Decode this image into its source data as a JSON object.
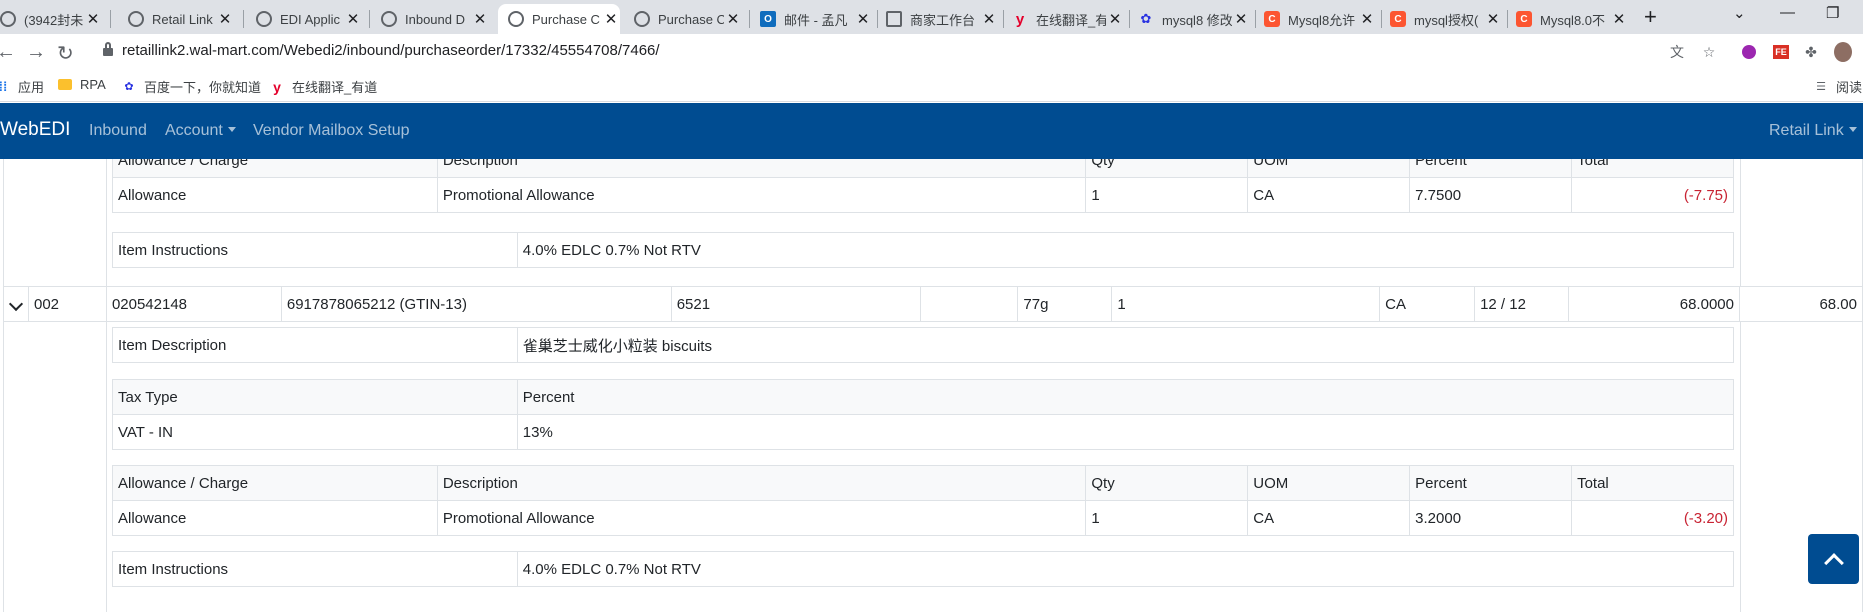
{
  "browser": {
    "tabs": [
      {
        "label": "(3942封未",
        "icon": "globe-icon"
      },
      {
        "label": "Retail Link",
        "icon": "globe-icon"
      },
      {
        "label": "EDI Applic",
        "icon": "globe-icon"
      },
      {
        "label": "Inbound D",
        "icon": "globe-icon"
      },
      {
        "label": "Purchase C",
        "icon": "globe-icon",
        "active": true
      },
      {
        "label": "Purchase C",
        "icon": "globe-icon"
      },
      {
        "label": "邮件 - 孟凡",
        "icon": "outlook-icon"
      },
      {
        "label": "商家工作台",
        "icon": "shop-icon"
      },
      {
        "label": "在线翻译_有",
        "icon": "youdao-icon"
      },
      {
        "label": "mysql8 修改",
        "icon": "baidu-icon"
      },
      {
        "label": "Mysql8允许",
        "icon": "csdn-icon"
      },
      {
        "label": "mysql授权(",
        "icon": "csdn-icon"
      },
      {
        "label": "Mysql8.0不",
        "icon": "csdn-icon"
      }
    ],
    "url": "retaillink2.wal-mart.com/Webedi2/inbound/purchaseorder/17332/45554708/7466/",
    "bookmarks": [
      {
        "label": "应用",
        "icon": "apps-icon"
      },
      {
        "label": "RPA",
        "icon": "folder-icon"
      },
      {
        "label": "百度一下，你就知道",
        "icon": "baidu-icon"
      },
      {
        "label": "在线翻译_有道",
        "icon": "youdao-icon"
      }
    ],
    "reading_list": "阅读"
  },
  "appnav": {
    "brand": "WebEDI",
    "links": [
      "Inbound",
      "Account",
      "Vendor Mailbox Setup"
    ],
    "right_link": "Retail Link"
  },
  "allowance_headers": [
    "Allowance / Charge",
    "Description",
    "Qty",
    "UOM",
    "Percent",
    "Total"
  ],
  "item1": {
    "allowance": {
      "type": "Allowance",
      "description": "Promotional Allowance",
      "qty": "1",
      "uom": "CA",
      "percent": "7.7500",
      "total": "(-7.75)"
    },
    "instructions_label": "Item Instructions",
    "instructions": "4.0% EDLC 0.7% Not RTV"
  },
  "item2": {
    "line": "002",
    "item_number": "020542148",
    "gtin": "6917878065212 (GTIN-13)",
    "supplier_stock": "6521",
    "color": "",
    "size": "77g",
    "qty": "1",
    "uom": "CA",
    "pack": "12 / 12",
    "unit_cost": "68.0000",
    "ext_cost": "68.00",
    "description_label": "Item Description",
    "description": "雀巢芝士威化小粒装 biscuits",
    "tax_headers": [
      "Tax Type",
      "Percent"
    ],
    "tax_type": "VAT - IN",
    "tax_percent": "13%",
    "allowance": {
      "type": "Allowance",
      "description": "Promotional Allowance",
      "qty": "1",
      "uom": "CA",
      "percent": "3.2000",
      "total": "(-3.20)"
    },
    "instructions_label": "Item Instructions",
    "instructions": "4.0% EDLC 0.7% Not RTV"
  }
}
